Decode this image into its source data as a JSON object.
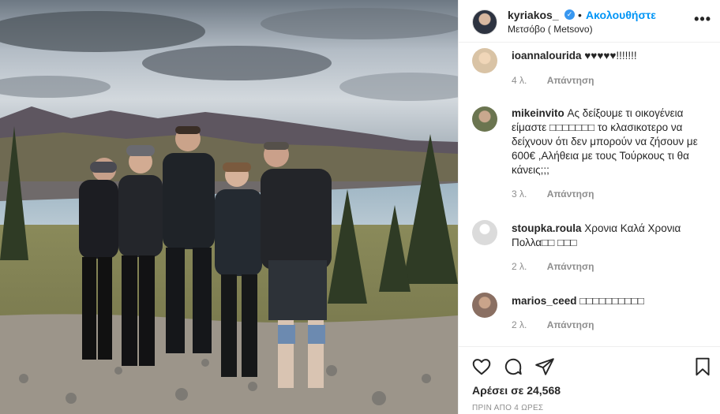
{
  "post": {
    "username": "kyriakos_",
    "verified_mark": "✓",
    "separator": "•",
    "follow_label": "Ακολουθήστε",
    "location": "Μετσόβο ( Metsovo)",
    "more_label": "•••"
  },
  "comments": [
    {
      "username": "ioannalourida",
      "text": "♥♥♥♥♥!!!!!!!",
      "age": "4 λ.",
      "reply_label": "Απάντηση",
      "avatar_color": "#d9c3a5"
    },
    {
      "username": "mikeinvito",
      "text": "Ας δείξουμε τι οικογένεια είμαστε □□□□□□□ το κλασικοτερο να δείχνουν ότι δεν μπορούν να ζήσουν με 600€ ,Αλήθεια με τους Τούρκους τι θα κάνεις;;;",
      "age": "3 λ.",
      "reply_label": "Απάντηση",
      "avatar_color": "#6b7550"
    },
    {
      "username": "stoupka.roula",
      "text": "Χρονια Καλά Χρονια Πολλα□□ □□□",
      "age": "2 λ.",
      "reply_label": "Απάντηση",
      "avatar_color": "#dbdbdb"
    },
    {
      "username": "marios_ceed",
      "text": "□□□□□□□□□□",
      "age": "2 λ.",
      "reply_label": "Απάντηση",
      "avatar_color": "#8a6f62"
    }
  ],
  "actions": {
    "like_icon": "heart-icon",
    "comment_icon": "comment-icon",
    "share_icon": "paper-plane-icon",
    "save_icon": "bookmark-icon"
  },
  "likes_text": "Αρέσει σε 24,568",
  "timestamp": "ΠΡΙΝ ΑΠΟ 4 ΩΡΕΣ",
  "colors": {
    "accent": "#0095f6",
    "verified": "#3897f0",
    "muted": "#8e8e8e"
  }
}
